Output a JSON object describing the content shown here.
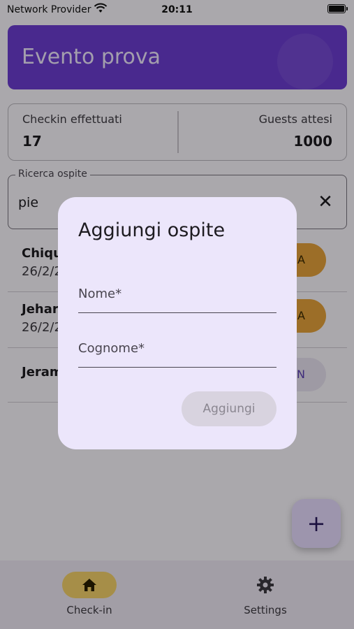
{
  "status_bar": {
    "carrier": "Network Provider",
    "time": "20:11"
  },
  "header": {
    "title": "Evento prova"
  },
  "stats": {
    "checkin_label": "Checkin effettuati",
    "checkin_value": "17",
    "guests_label": "Guests attesi",
    "guests_value": "1000"
  },
  "search": {
    "label": "Ricerca ospite",
    "value": "pie"
  },
  "guests": [
    {
      "name": "Chiqu",
      "date": "26/2/2",
      "status": "A"
    },
    {
      "name": "Jehar",
      "date": "26/2/2",
      "status": "A"
    },
    {
      "name": "Jeram",
      "date": "",
      "status": "N"
    }
  ],
  "fab": {
    "label": "+"
  },
  "nav": {
    "checkin": "Check-in",
    "settings": "Settings"
  },
  "dialog": {
    "title": "Aggiungi ospite",
    "nome_label": "Nome*",
    "cognome_label": "Cognome*",
    "submit_label": "Aggiungi"
  }
}
